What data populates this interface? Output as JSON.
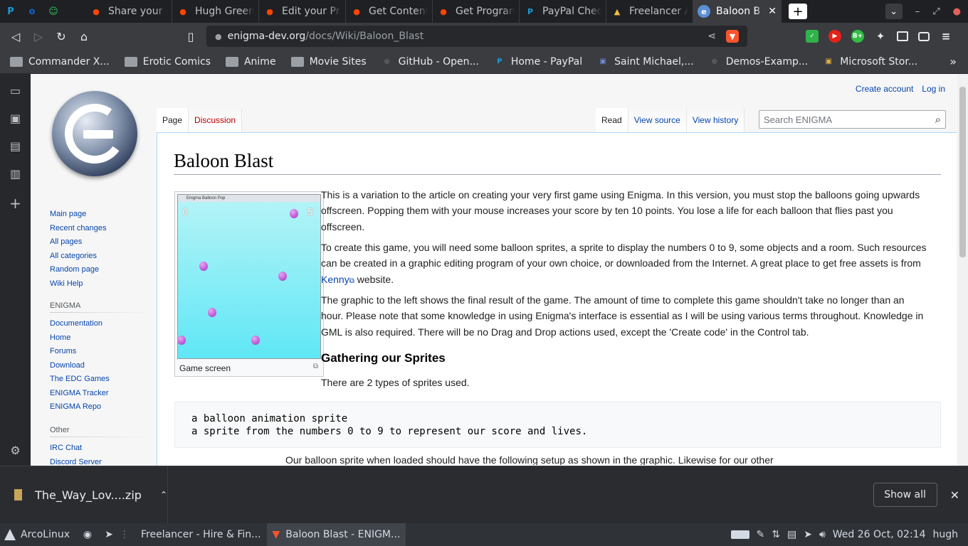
{
  "browser": {
    "pinned_tabs": [
      {
        "icon": "paypal-icon",
        "glyph": "P",
        "color": "#179bd7"
      },
      {
        "icon": "outlook-icon",
        "glyph": "o",
        "color": "#0a64d6"
      },
      {
        "icon": "smiley-icon",
        "glyph": "☺",
        "color": "#2fc55a"
      }
    ],
    "tabs": [
      {
        "title": "Share your F",
        "icon": "reddit-icon",
        "color": "#ff4500",
        "glyph": "●"
      },
      {
        "title": "Hugh Green",
        "icon": "reddit-icon",
        "color": "#ff4500",
        "glyph": "●"
      },
      {
        "title": "Edit your Pr",
        "icon": "reddit-icon",
        "color": "#ff4500",
        "glyph": "●"
      },
      {
        "title": "Get Content",
        "icon": "reddit-icon",
        "color": "#ff4500",
        "glyph": "●"
      },
      {
        "title": "Get Progran",
        "icon": "reddit-icon",
        "color": "#ff4500",
        "glyph": "●"
      },
      {
        "title": "PayPal Chec",
        "icon": "paypal-icon",
        "color": "#179bd7",
        "glyph": "P"
      },
      {
        "title": "Freelancer A",
        "icon": "freelancer-icon",
        "color": "#f3c03b",
        "glyph": "▲"
      }
    ],
    "active_tab": {
      "title": "Baloon B",
      "close": "✕"
    },
    "new_tab": "+",
    "window_controls": {
      "minimize": "–",
      "restore": "⤢",
      "close": "●"
    },
    "url": {
      "host": "enigma-dev.org",
      "path": "/docs/Wiki/Baloon_Blast"
    },
    "brave_glyph": "▼",
    "bookmarks": [
      {
        "label": "Commander X...",
        "type": "folder"
      },
      {
        "label": "Erotic Comics",
        "type": "folder"
      },
      {
        "label": "Anime",
        "type": "folder"
      },
      {
        "label": "Movie Sites",
        "type": "folder"
      },
      {
        "label": "GitHub - Open...",
        "type": "site",
        "icon": "github-icon",
        "color": "#555",
        "glyph": "●"
      },
      {
        "label": "Home - PayPal",
        "type": "site",
        "icon": "paypal-icon",
        "color": "#179bd7",
        "glyph": "P"
      },
      {
        "label": "Saint Michael,...",
        "type": "site",
        "icon": "image-icon",
        "color": "#6d8bd8",
        "glyph": "▣"
      },
      {
        "label": "Demos-Examp...",
        "type": "site",
        "icon": "github-icon",
        "color": "#555",
        "glyph": "●"
      },
      {
        "label": "Microsoft Stor...",
        "type": "site",
        "icon": "store-icon",
        "color": "#e8b339",
        "glyph": "▣"
      }
    ],
    "more": "»"
  },
  "wiki": {
    "personal": {
      "create_account": "Create account",
      "login": "Log in"
    },
    "tabs_left": [
      {
        "label": "Page",
        "selected": true
      },
      {
        "label": "Discussion",
        "selected": false
      }
    ],
    "tabs_right": [
      {
        "label": "Read",
        "selected": true
      },
      {
        "label": "View source",
        "selected": false
      },
      {
        "label": "View history",
        "selected": false
      }
    ],
    "search_placeholder": "Search ENIGMA",
    "nav_main": [
      "Main page",
      "Recent changes",
      "All pages",
      "All categories",
      "Random page",
      "Wiki Help"
    ],
    "nav_enigma_heading": "ENIGMA",
    "nav_enigma": [
      "Documentation",
      "Home",
      "Forums",
      "Download",
      "The EDC Games",
      "ENIGMA Tracker",
      "ENIGMA Repo"
    ],
    "nav_other_heading": "Other",
    "nav_other": [
      "IRC Chat",
      "Discord Server"
    ],
    "title": "Baloon Blast",
    "thumb": {
      "window_title": "Enigma Balloon Pop",
      "score": "0",
      "lives": "5",
      "caption": "Game screen"
    },
    "p1": "This is a variation to the article on creating your very first game using Enigma. In this version, you must stop the balloons going upwards offscreen. Popping them with your mouse increases your score by ten 10 points. You lose a life for each balloon that flies past you offscreen.",
    "p2_before": "To create this game, you will need some balloon sprites, a sprite to display the numbers 0 to 9, some objects and a room. Such resources can be created in a graphic editing program of your own choice, or downloaded from the Internet. A great place to get free assets is from ",
    "p2_link": "Kenny",
    "p2_after": " website.",
    "p3": "The graphic to the left shows the final result of the game. The amount of time to complete this game shouldn't take no longer than an hour. Please note that some knowledge in using Enigma's interface is essential as I will be using various terms throughout. Knowledge in GML is also required. There will be no Drag and Drop actions used, except the 'Create code' in the Control tab.",
    "h2": "Gathering our Sprites",
    "p4": "There are 2 types of sprites used.",
    "pre": "a balloon animation sprite\na sprite from the numbers 0 to 9 to represent our score and lives.",
    "p5": "Our balloon sprite when loaded should have the following setup as shown in the graphic. Likewise for our other"
  },
  "download": {
    "file": "The_Way_Lov....zip",
    "show_all": "Show all"
  },
  "taskbar": {
    "start": "ArcoLinux",
    "tasks": [
      {
        "label": "Freelancer - Hire & Fin...",
        "active": false
      },
      {
        "label": "Baloon Blast - ENIGM...",
        "active": true
      }
    ],
    "clock": "Wed 26 Oct, 02:14",
    "user": "hugh"
  }
}
